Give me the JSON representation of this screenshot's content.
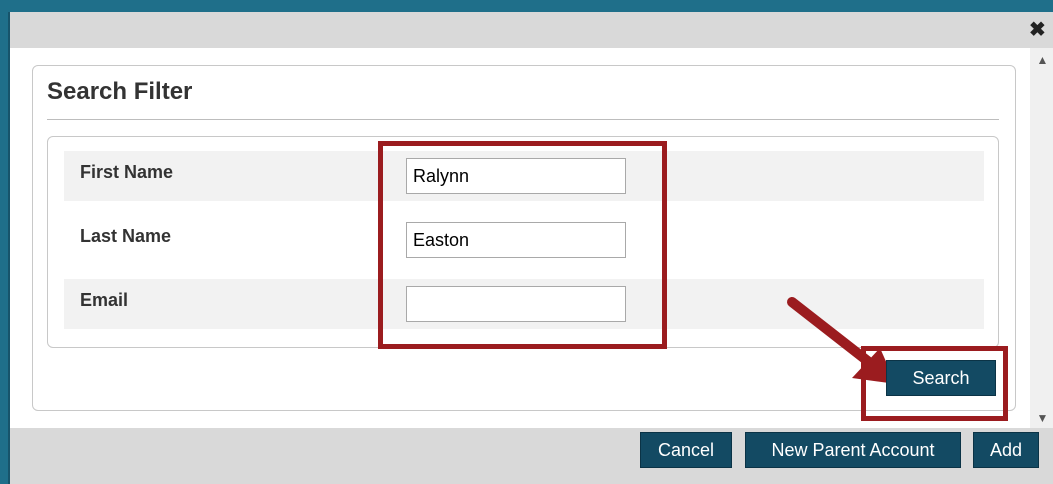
{
  "dialog": {
    "close_icon": "close-icon"
  },
  "panel": {
    "title": "Search Filter"
  },
  "fields": [
    {
      "label": "First Name",
      "value": "Ralynn",
      "placeholder": ""
    },
    {
      "label": "Last Name",
      "value": "Easton",
      "placeholder": ""
    },
    {
      "label": "Email",
      "value": "",
      "placeholder": ""
    }
  ],
  "buttons": {
    "search": "Search",
    "cancel": "Cancel",
    "new_parent_account": "New Parent Account",
    "add": "Add"
  },
  "colors": {
    "accent": "#134a63",
    "highlight": "#9b1c1f"
  }
}
